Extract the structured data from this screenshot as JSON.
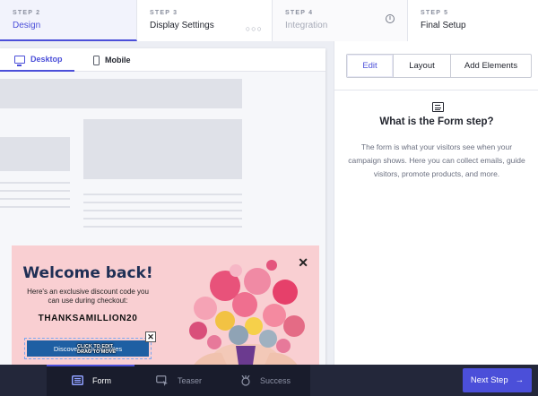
{
  "steps": [
    {
      "num": "STEP 2",
      "title": "Design",
      "state": "active"
    },
    {
      "num": "STEP 3",
      "title": "Display Settings",
      "state": "normal",
      "dots": "○○○"
    },
    {
      "num": "STEP 4",
      "title": "Integration",
      "state": "disabled",
      "info_icon": "i"
    },
    {
      "num": "STEP 5",
      "title": "Final Setup",
      "state": "normal"
    }
  ],
  "device_tabs": {
    "desktop": "Desktop",
    "mobile": "Mobile",
    "active": "desktop"
  },
  "popup": {
    "title": "Welcome back!",
    "text": "Here's an exclusive discount code you can use during checkout:",
    "code": "THANKSAMILLION20",
    "button_label": "Discover your favorites",
    "close_glyph": "✕",
    "button_close_glyph": "✕",
    "drag_hint_line1": "CLICK TO EDIT",
    "drag_hint_line2": "DRAG TO MOVE",
    "background_color": "#f9cfd2",
    "button_color": "#1e5fa3",
    "title_color": "#1f2f55"
  },
  "right_panel": {
    "tabs": [
      {
        "label": "Edit",
        "active": true
      },
      {
        "label": "Layout",
        "active": false
      },
      {
        "label": "Add Elements",
        "active": false
      }
    ],
    "icon": "form-icon",
    "title": "What is the Form step?",
    "description": "The form is what your visitors see when your campaign shows. Here you can collect emails, guide visitors, promote products, and more."
  },
  "bottom_bar": {
    "tabs": [
      {
        "label": "Form",
        "icon": "form-icon",
        "active": true
      },
      {
        "label": "Teaser",
        "icon": "teaser-cursor-icon",
        "active": false
      },
      {
        "label": "Success",
        "icon": "success-badge-icon",
        "active": false
      }
    ],
    "next_label": "Next Step",
    "next_arrow": "→"
  },
  "colors": {
    "accent": "#4b4fd9",
    "bottom_bar": "#23273a"
  }
}
